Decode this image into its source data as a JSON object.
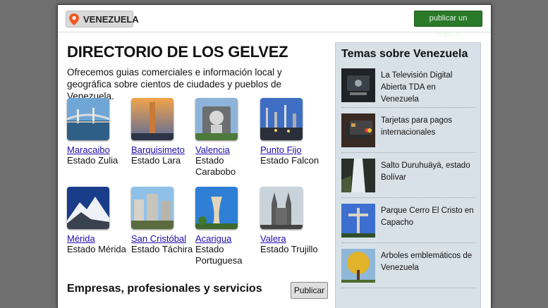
{
  "header": {
    "brand": "VENEZUELA",
    "publish_button": "publicar un negocio"
  },
  "main": {
    "title": "DIRECTORIO DE LOS GELVEZ",
    "intro": "Ofrecemos guias comerciales e información local y geográfica sobre cientos de ciudades y pueblos de Venezuela.",
    "cities": [
      {
        "name": "Maracaibo",
        "state": "Estado Zulia"
      },
      {
        "name": "Barquisimeto",
        "state": "Estado Lara"
      },
      {
        "name": "Valencia",
        "state": "Estado Carabobo"
      },
      {
        "name": "Punto Fijo",
        "state": "Estado Falcon"
      },
      {
        "name": "Mérida",
        "state": "Estado Mérida"
      },
      {
        "name": "San Cristóbal",
        "state": "Estado Táchira"
      },
      {
        "name": "Acarigua",
        "state": "Estado Portuguesa"
      },
      {
        "name": "Valera",
        "state": "Estado Trujillo"
      }
    ],
    "business_heading": "Empresas, profesionales y servicios",
    "publish_label": "Publicar"
  },
  "sidebar": {
    "title": "Temas sobre Venezuela",
    "topics": [
      {
        "label": "La Televisión Digital Abierta TDA en Venezuela"
      },
      {
        "label": "Tarjetas para pagos internacionales"
      },
      {
        "label": "Salto Duruhuäyä, estado Bolívar"
      },
      {
        "label": "Parque Cerro El Cristo en Capacho"
      },
      {
        "label": "Arboles emblemáticos de Venezuela"
      }
    ]
  }
}
